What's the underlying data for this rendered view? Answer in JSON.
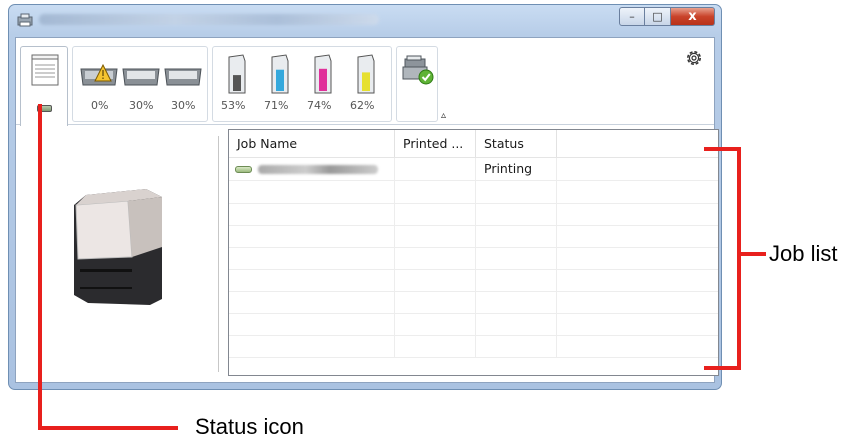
{
  "window": {
    "title": "",
    "buttons": {
      "minimize": "–",
      "maximize": "□",
      "close": "x"
    }
  },
  "toolbar": {
    "toner_trays": [
      {
        "name": "tray-1",
        "percent": "0%",
        "warning": true
      },
      {
        "name": "tray-2",
        "percent": "30%",
        "warning": false
      },
      {
        "name": "tray-3",
        "percent": "30%",
        "warning": false
      }
    ],
    "toner_levels": [
      {
        "color": "#555555",
        "percent": "53%",
        "level": 0.53
      },
      {
        "color": "#35a8dc",
        "percent": "71%",
        "level": 0.71
      },
      {
        "color": "#e0309a",
        "percent": "74%",
        "level": 0.74
      },
      {
        "color": "#e6e030",
        "percent": "62%",
        "level": 0.62
      }
    ],
    "collapse_icon": "chevron-up-icon",
    "settings_icon": "gear-icon"
  },
  "job_list": {
    "columns": [
      "Job Name",
      "Printed ...",
      "Status"
    ],
    "rows": [
      {
        "name": "",
        "printed": "",
        "status": "Printing"
      }
    ],
    "empty_rows": 8
  },
  "annotations": {
    "job_list_label": "Job list",
    "status_icon_label": "Status icon",
    "accent_color": "#e8201d"
  }
}
